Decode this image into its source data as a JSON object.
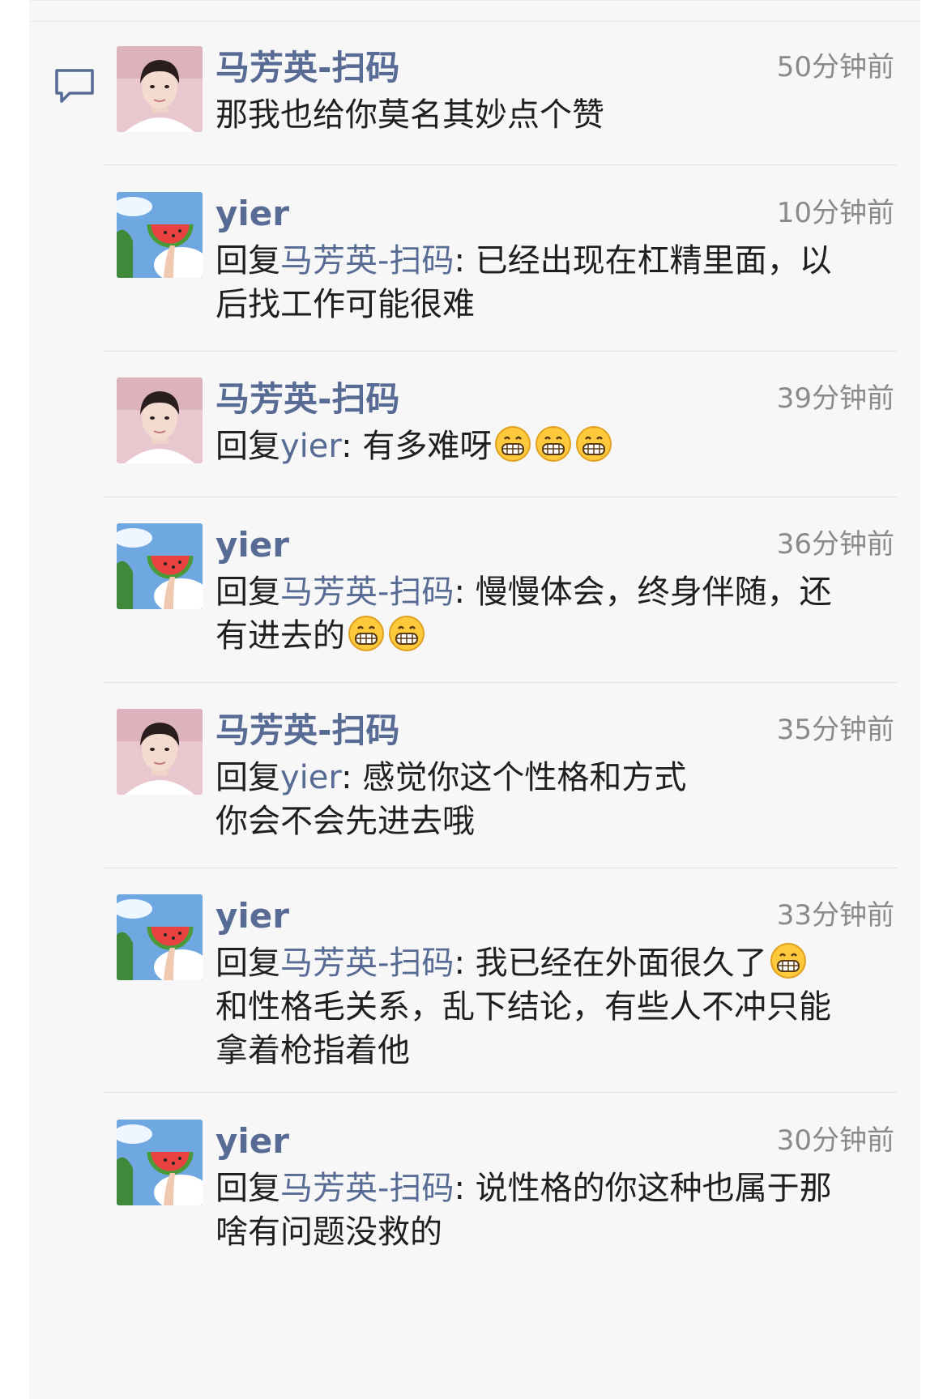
{
  "colors": {
    "name": "#576b95",
    "text": "#1f1f1f",
    "time": "#8a8a8a",
    "background": "#f7f7f7"
  },
  "icons": {
    "comment": "speech-bubble-icon",
    "emoji": "grinning-emoji-icon"
  },
  "comments": [
    {
      "user": "马芳英-扫码",
      "avatar": "pink-portrait-avatar",
      "time": "50分钟前",
      "lines": [
        "那我也给你莫名其妙点个赞"
      ]
    },
    {
      "user": "yier",
      "avatar": "watermelon-sky-avatar",
      "time": "10分钟前",
      "reply_prefix": "回复",
      "reply_to": "马芳英-扫码",
      "colon": ":",
      "lines": [
        " 已经出现在杠精里面，以",
        "后找工作可能很难"
      ]
    },
    {
      "user": "马芳英-扫码",
      "avatar": "pink-portrait-avatar",
      "time": "39分钟前",
      "reply_prefix": "回复",
      "reply_to": "yier",
      "colon": ":",
      "lines": [
        " 有多难呀"
      ]
    },
    {
      "user": "yier",
      "avatar": "watermelon-sky-avatar",
      "time": "36分钟前",
      "reply_prefix": "回复",
      "reply_to": "马芳英-扫码",
      "colon": ":",
      "lines": [
        " 慢慢体会，终身伴随，还",
        "有进去的"
      ]
    },
    {
      "user": "马芳英-扫码",
      "avatar": "pink-portrait-avatar",
      "time": "35分钟前",
      "reply_prefix": "回复",
      "reply_to": "yier",
      "colon": ":",
      "lines": [
        " 感觉你这个性格和方式",
        "你会不会先进去哦"
      ]
    },
    {
      "user": "yier",
      "avatar": "watermelon-sky-avatar",
      "time": "33分钟前",
      "reply_prefix": "回复",
      "reply_to": "马芳英-扫码",
      "colon": ":",
      "lines": [
        " 我已经在外面很久了",
        "和性格毛关系，乱下结论，有些人不冲只能",
        "拿着枪指着他"
      ]
    },
    {
      "user": "yier",
      "avatar": "watermelon-sky-avatar",
      "time": "30分钟前",
      "reply_prefix": "回复",
      "reply_to": "马芳英-扫码",
      "colon": ":",
      "lines": [
        " 说性格的你这种也属于那",
        "啥有问题没救的"
      ]
    }
  ]
}
